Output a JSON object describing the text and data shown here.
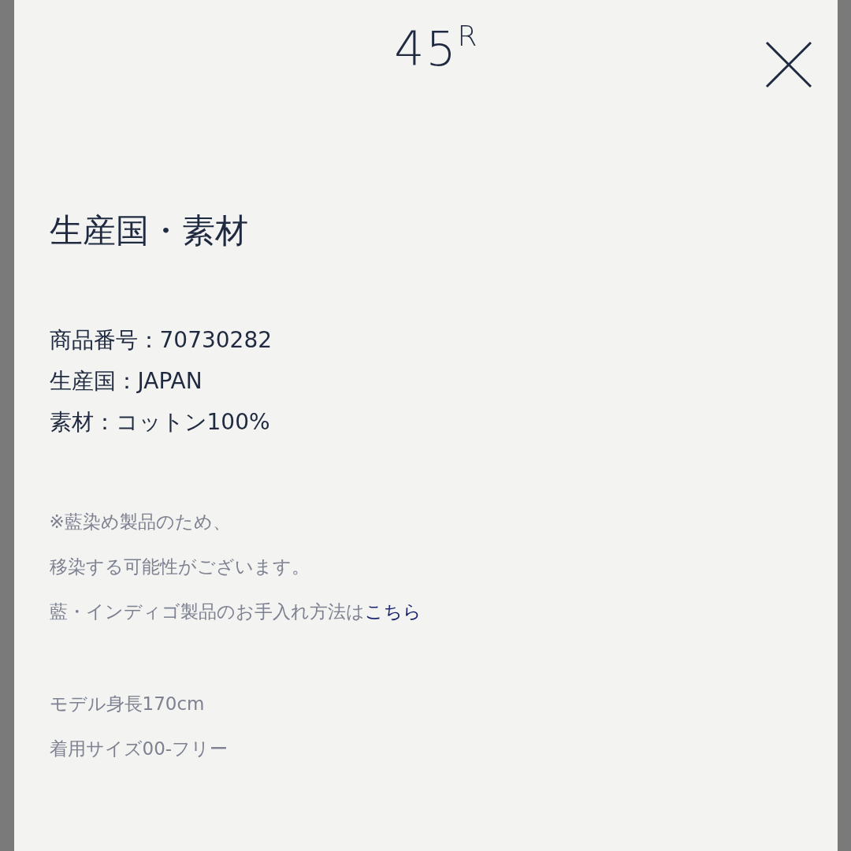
{
  "header": {
    "logo": "45$^{R}$"
  },
  "section": {
    "title": "生産国・素材",
    "details": [
      "商品番号：70730282",
      "生産国：JAPAN",
      "素材：コットン100%"
    ],
    "notes": [
      "※藍染め製品のため、",
      "移染する可能性がございます。"
    ],
    "care": {
      "text": "藍・インディゴ製品のお手入れ方法は",
      "link": "こちら"
    },
    "model": [
      "モデル身長170cm",
      "着用サイズ00-フリー"
    ]
  }
}
